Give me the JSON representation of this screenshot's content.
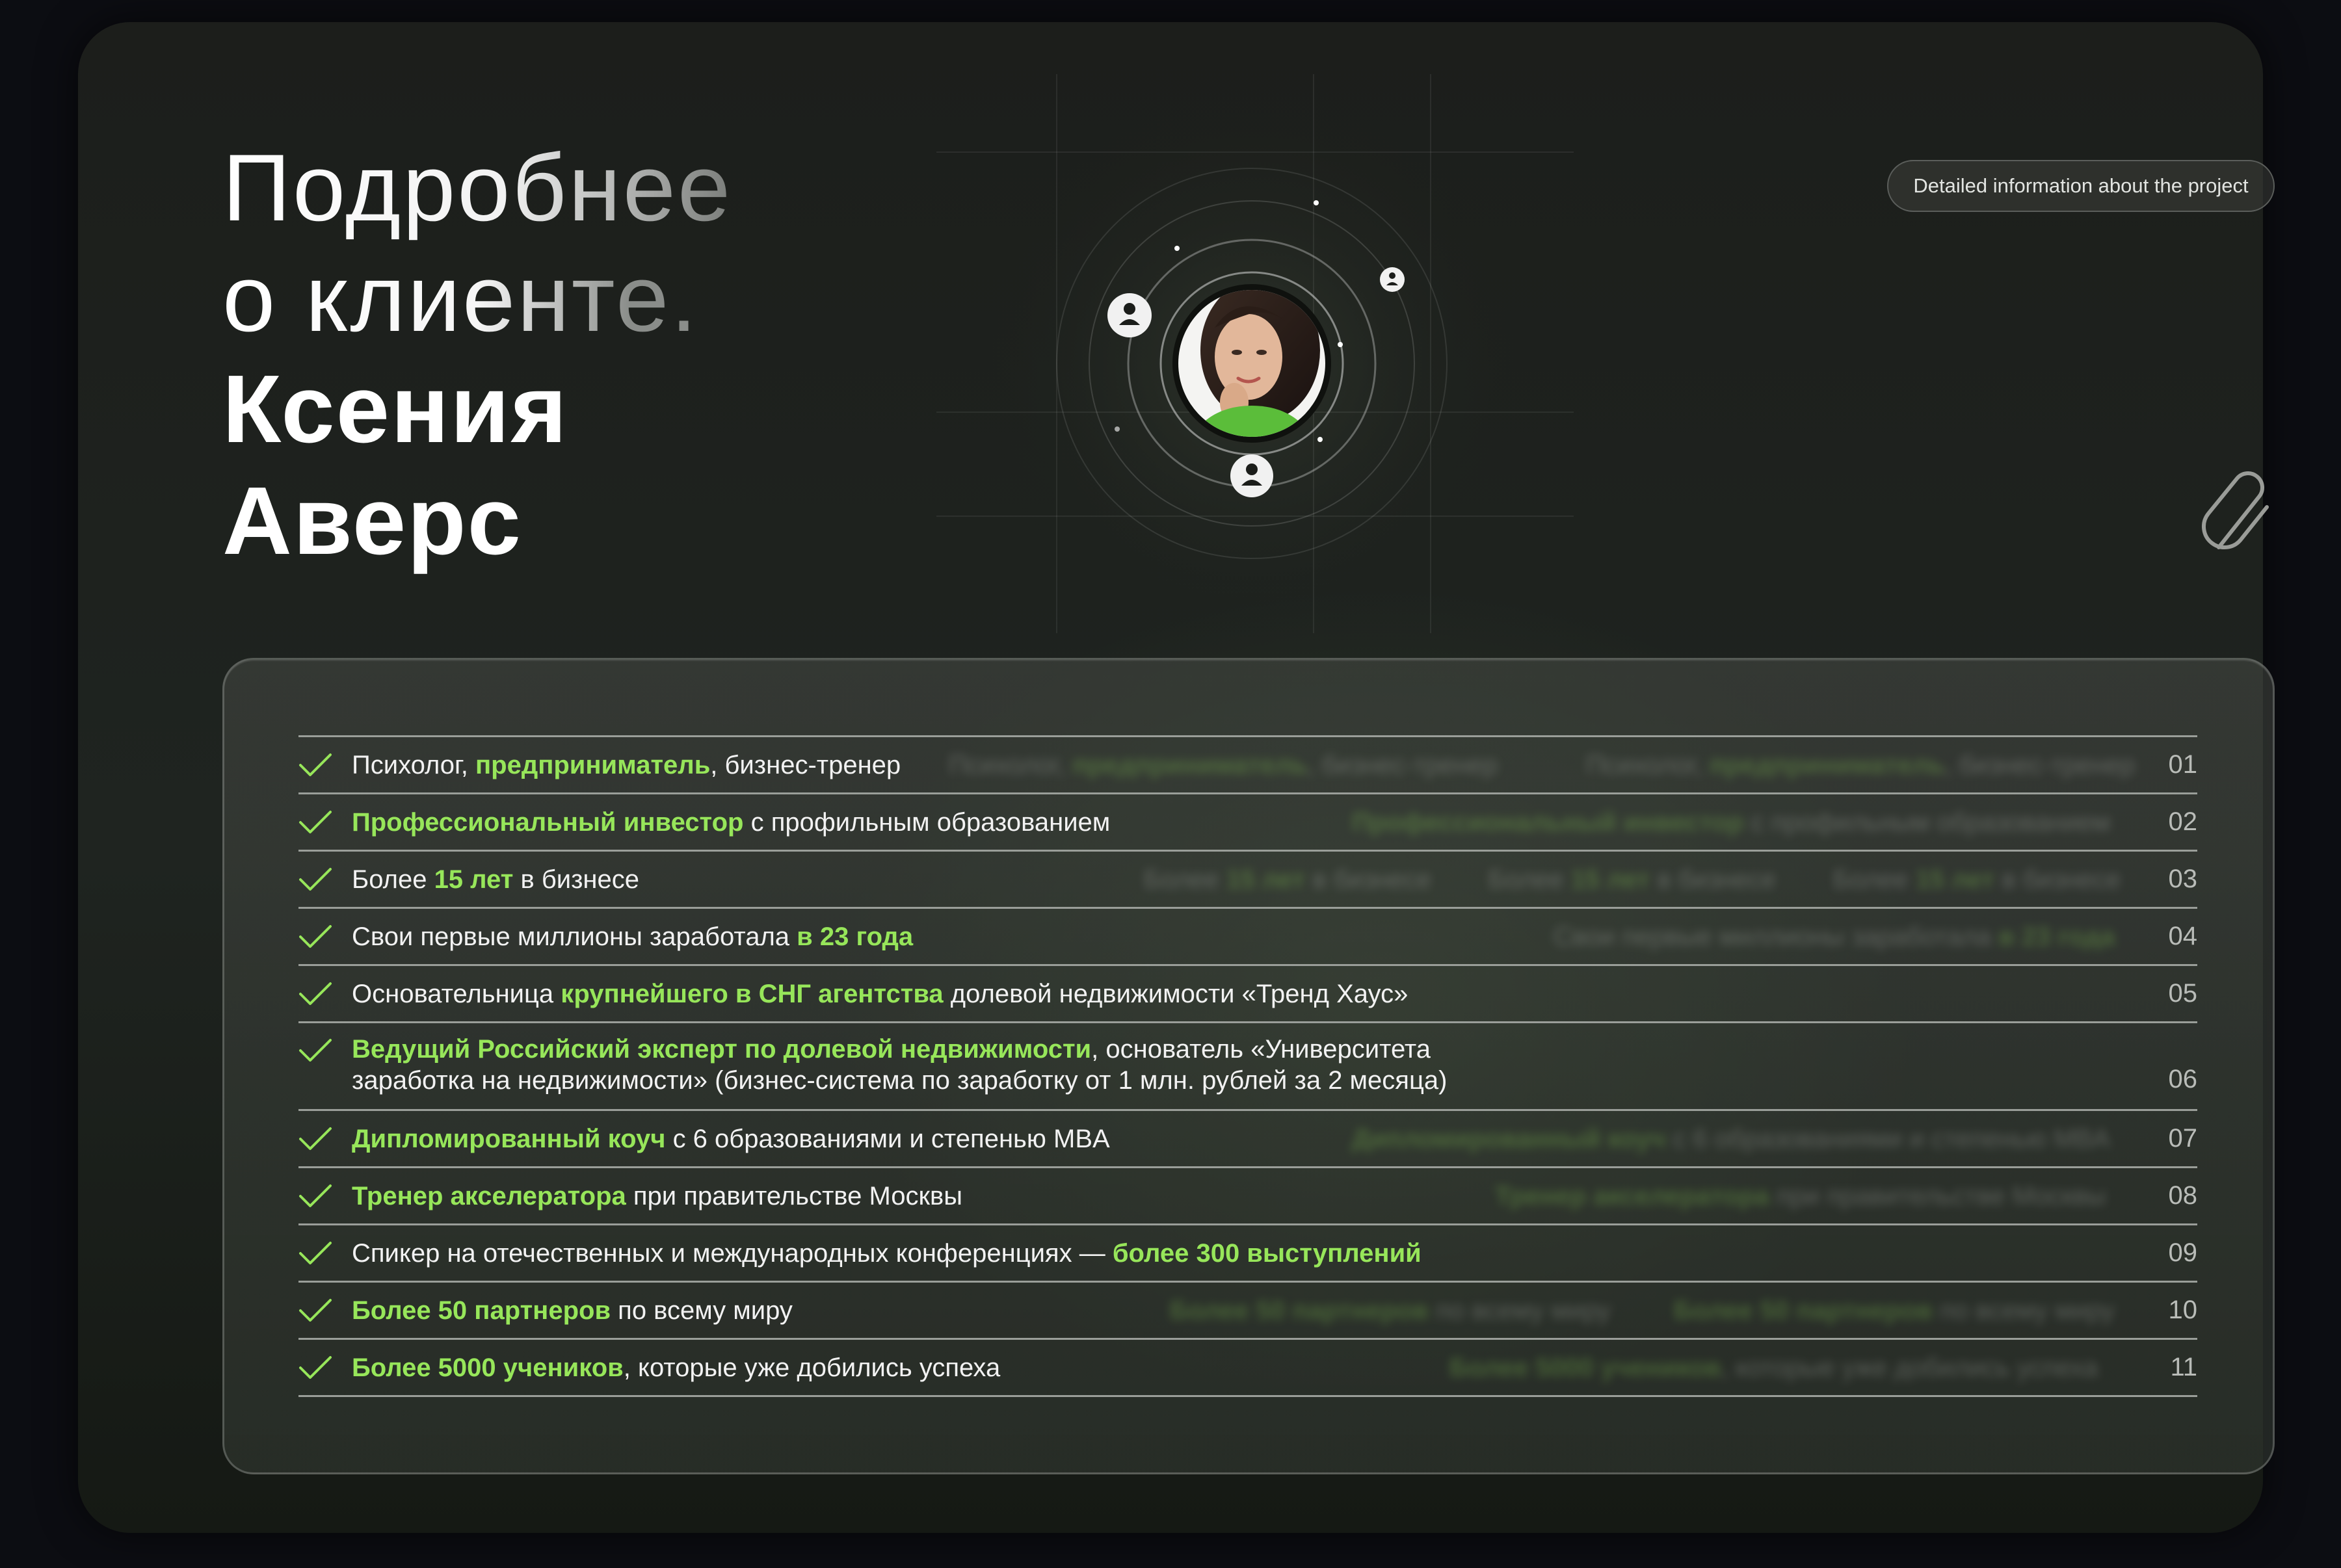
{
  "title": {
    "line1": "Подробнее",
    "line2": "о клиенте.",
    "line3": "Ксения",
    "line4": "Аверс"
  },
  "badge": "Detailed information about the project",
  "icons": {
    "attach": "paperclip-icon",
    "avatar": "client-portrait",
    "user": "user-icon",
    "check": "check-icon"
  },
  "colors": {
    "accent": "#97e65a",
    "background": "#1c1f1b"
  },
  "facts": [
    {
      "pre": "Психолог, ",
      "hl": "предприниматель",
      "post": ", бизнес-тренер",
      "num": "01"
    },
    {
      "pre": "",
      "hl": "Профессиональный инвестор",
      "post": " с профильным образованием",
      "num": "02"
    },
    {
      "pre": "Более ",
      "hl": "15 лет",
      "post": " в бизнесе",
      "num": "03"
    },
    {
      "pre": "Свои первые миллионы заработала ",
      "hl": "в 23 года",
      "post": "",
      "num": "04"
    },
    {
      "pre": "Основательница ",
      "hl": "крупнейшего в СНГ агентства",
      "post": " долевой недвижимости «Тренд Хаус»",
      "num": "05"
    },
    {
      "pre": "",
      "hl": "Ведущий Российский эксперт по долевой недвижимости",
      "post": ", основатель «Университета",
      "post2": "заработка на недвижимости» (бизнес-система по заработку от 1 млн. рублей за 2 месяца)",
      "num": "06"
    },
    {
      "pre": "",
      "hl": "Дипломированный коуч",
      "post": " с 6 образованиями и степенью MBA",
      "num": "07"
    },
    {
      "pre": "",
      "hl": "Тренер акселератора",
      "post": " при правительстве Москвы",
      "num": "08"
    },
    {
      "pre": "Спикер на отечественных и международных конференциях — ",
      "hl": "более 300 выступлений",
      "post": "",
      "num": "09"
    },
    {
      "pre": "",
      "hl": "Более 50 партнеров",
      "post": " по всему миру",
      "num": "10"
    },
    {
      "pre": "",
      "hl": "Более 5000 учеников",
      "post": ", которые уже добились успеха",
      "num": "11"
    }
  ]
}
